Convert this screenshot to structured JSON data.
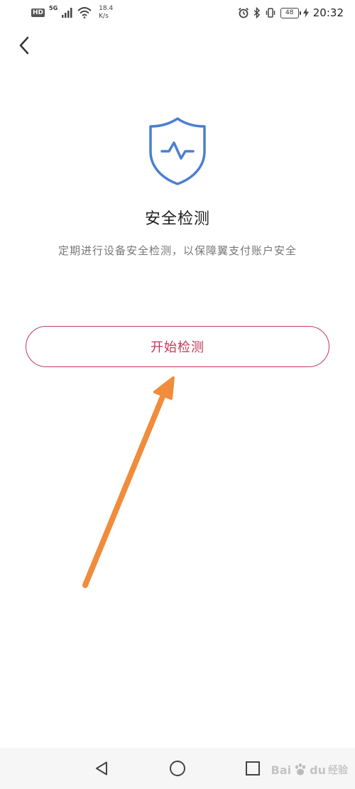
{
  "status_bar": {
    "hd": "HD",
    "network": "5G",
    "speed_value": "18.4",
    "speed_unit": "K/s",
    "battery": "48",
    "time": "20:32"
  },
  "header": {
    "back_icon": "chevron-left-icon"
  },
  "main": {
    "icon": "shield-pulse-icon",
    "title": "安全检测",
    "description": "定期进行设备安全检测，以保障翼支付账户安全",
    "start_button_label": "开始检测"
  },
  "nav_bar": {
    "back_icon": "triangle-back-icon",
    "home_icon": "circle-home-icon",
    "recent_icon": "square-recent-icon"
  },
  "watermark": {
    "brand_a": "Bai",
    "brand_b": "du",
    "suffix": "经验"
  },
  "colors": {
    "accent": "#c0375a",
    "shield": "#4a7fd1",
    "arrow": "#f08c3c",
    "nav_bg": "#f6f6f6"
  }
}
